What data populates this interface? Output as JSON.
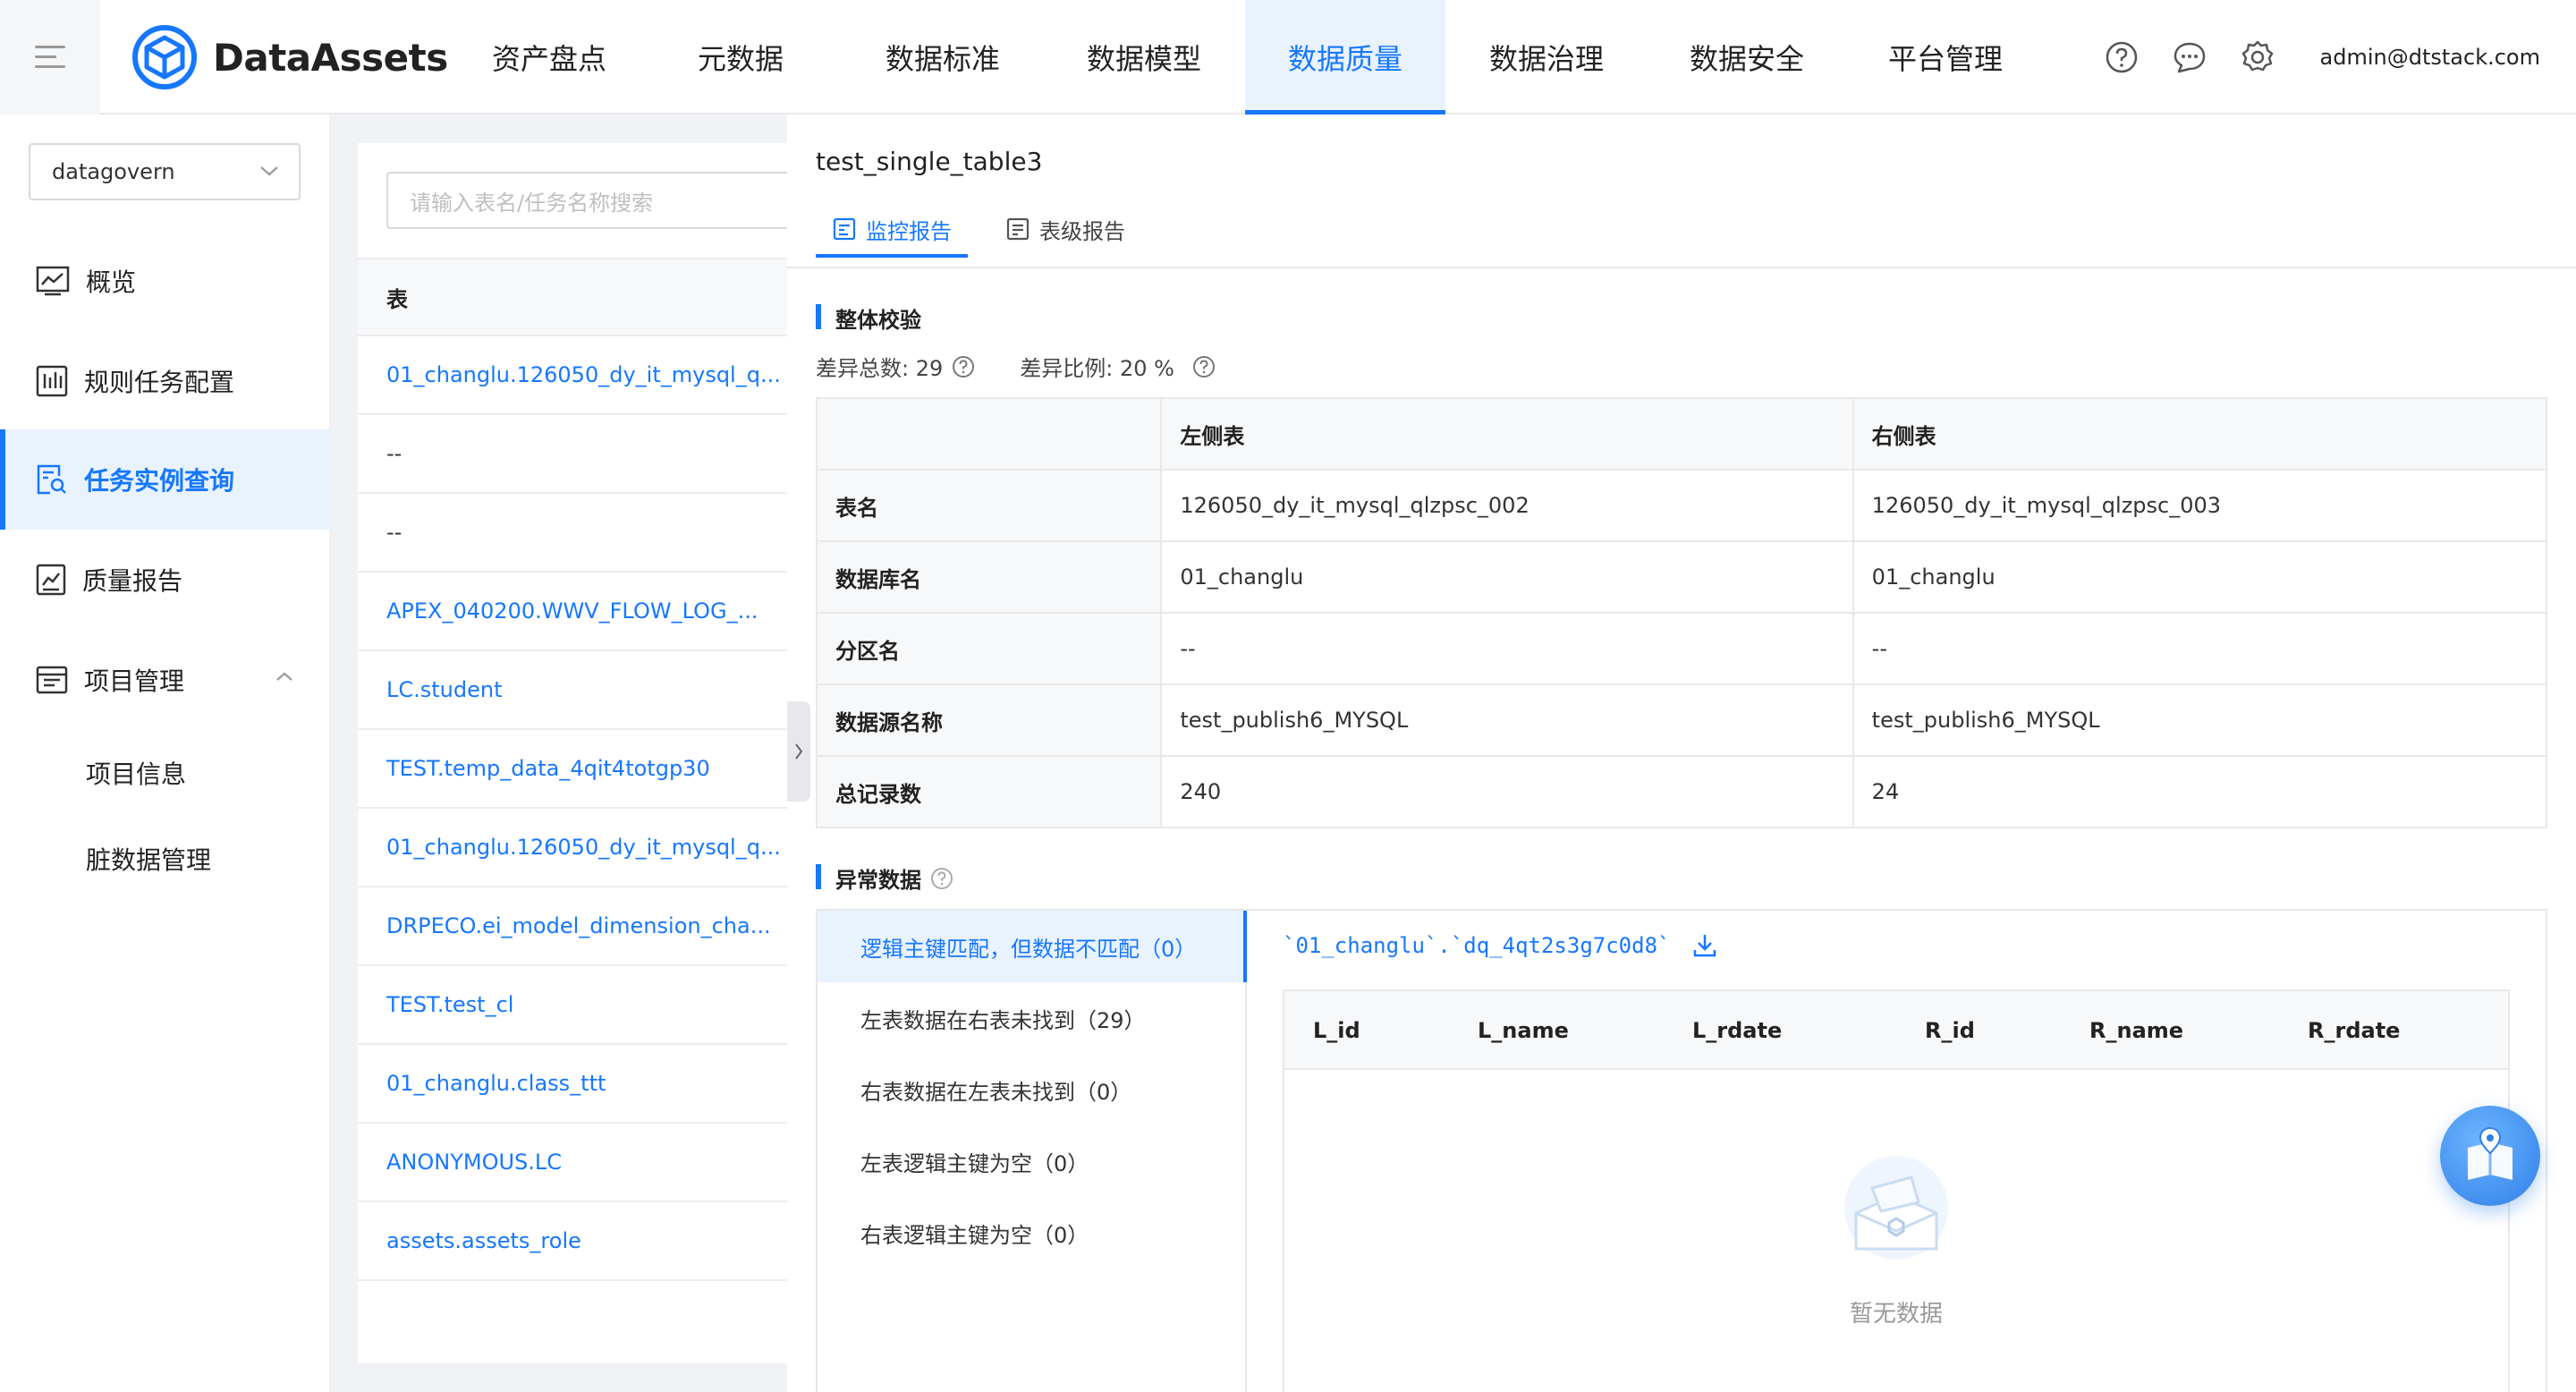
{
  "app": {
    "name": "DataAssets",
    "user": "admin@dtstack.com"
  },
  "topnav": {
    "items": [
      {
        "label": "资产盘点"
      },
      {
        "label": "元数据"
      },
      {
        "label": "数据标准"
      },
      {
        "label": "数据模型"
      },
      {
        "label": "数据质量",
        "active": true
      },
      {
        "label": "数据治理"
      },
      {
        "label": "数据安全"
      },
      {
        "label": "平台管理"
      }
    ],
    "icons": [
      "help-icon",
      "message-icon",
      "settings-icon"
    ]
  },
  "sidebar": {
    "project": "datagovern",
    "items": [
      {
        "label": "概览",
        "icon": "overview-icon"
      },
      {
        "label": "规则任务配置",
        "icon": "rule-icon"
      },
      {
        "label": "任务实例查询",
        "icon": "search-doc-icon",
        "active": true
      },
      {
        "label": "质量报告",
        "icon": "report-icon"
      },
      {
        "label": "项目管理",
        "icon": "project-icon",
        "expanded": true
      }
    ],
    "subitems": [
      "项目信息",
      "脏数据管理"
    ]
  },
  "table_list": {
    "search_placeholder": "请输入表名/任务名称搜索",
    "header": "表",
    "rows": [
      "01_changlu.126050_dy_it_mysql_q...",
      "--",
      "--",
      "APEX_040200.WWV_FLOW_LOG_...",
      "LC.student",
      "TEST.temp_data_4qit4totgp30",
      "01_changlu.126050_dy_it_mysql_q...",
      "DRPECO.ei_model_dimension_cha...",
      "TEST.test_cl",
      "01_changlu.class_ttt",
      "ANONYMOUS.LC",
      "assets.assets_role"
    ]
  },
  "detail": {
    "title": "test_single_table3",
    "tabs": [
      {
        "label": "监控报告",
        "active": true
      },
      {
        "label": "表级报告"
      }
    ],
    "overall": {
      "section_title": "整体校验",
      "diff_total_label": "差异总数: 29",
      "diff_ratio_label": "差异比例: 20 %"
    },
    "compare": {
      "headers": [
        "",
        "左侧表",
        "右侧表"
      ],
      "rows": [
        {
          "label": "表名",
          "left": "126050_dy_it_mysql_qlzpsc_002",
          "right": "126050_dy_it_mysql_qlzpsc_003"
        },
        {
          "label": "数据库名",
          "left": "01_changlu",
          "right": "01_changlu"
        },
        {
          "label": "分区名",
          "left": "--",
          "right": "--"
        },
        {
          "label": "数据源名称",
          "left": "test_publish6_MYSQL",
          "right": "test_publish6_MYSQL"
        },
        {
          "label": "总记录数",
          "left": "240",
          "right": "24"
        }
      ]
    },
    "abnormal": {
      "section_title": "异常数据",
      "categories": [
        {
          "label": "逻辑主键匹配，但数据不匹配（0）",
          "active": true
        },
        {
          "label": "左表数据在右表未找到（29）"
        },
        {
          "label": "右表数据在左表未找到（0）"
        },
        {
          "label": "左表逻辑主键为空（0）"
        },
        {
          "label": "右表逻辑主键为空（0）"
        }
      ],
      "table_path": "`01_changlu`.`dq_4qt2s3g7c0d8`",
      "columns": [
        "L_id",
        "L_name",
        "L_rdate",
        "R_id",
        "R_name",
        "R_rdate"
      ],
      "empty_text": "暂无数据"
    }
  },
  "colors": {
    "accent": "#1677ff",
    "active_bg": "#e9f3ff",
    "page_bg": "#f0f2f5"
  }
}
